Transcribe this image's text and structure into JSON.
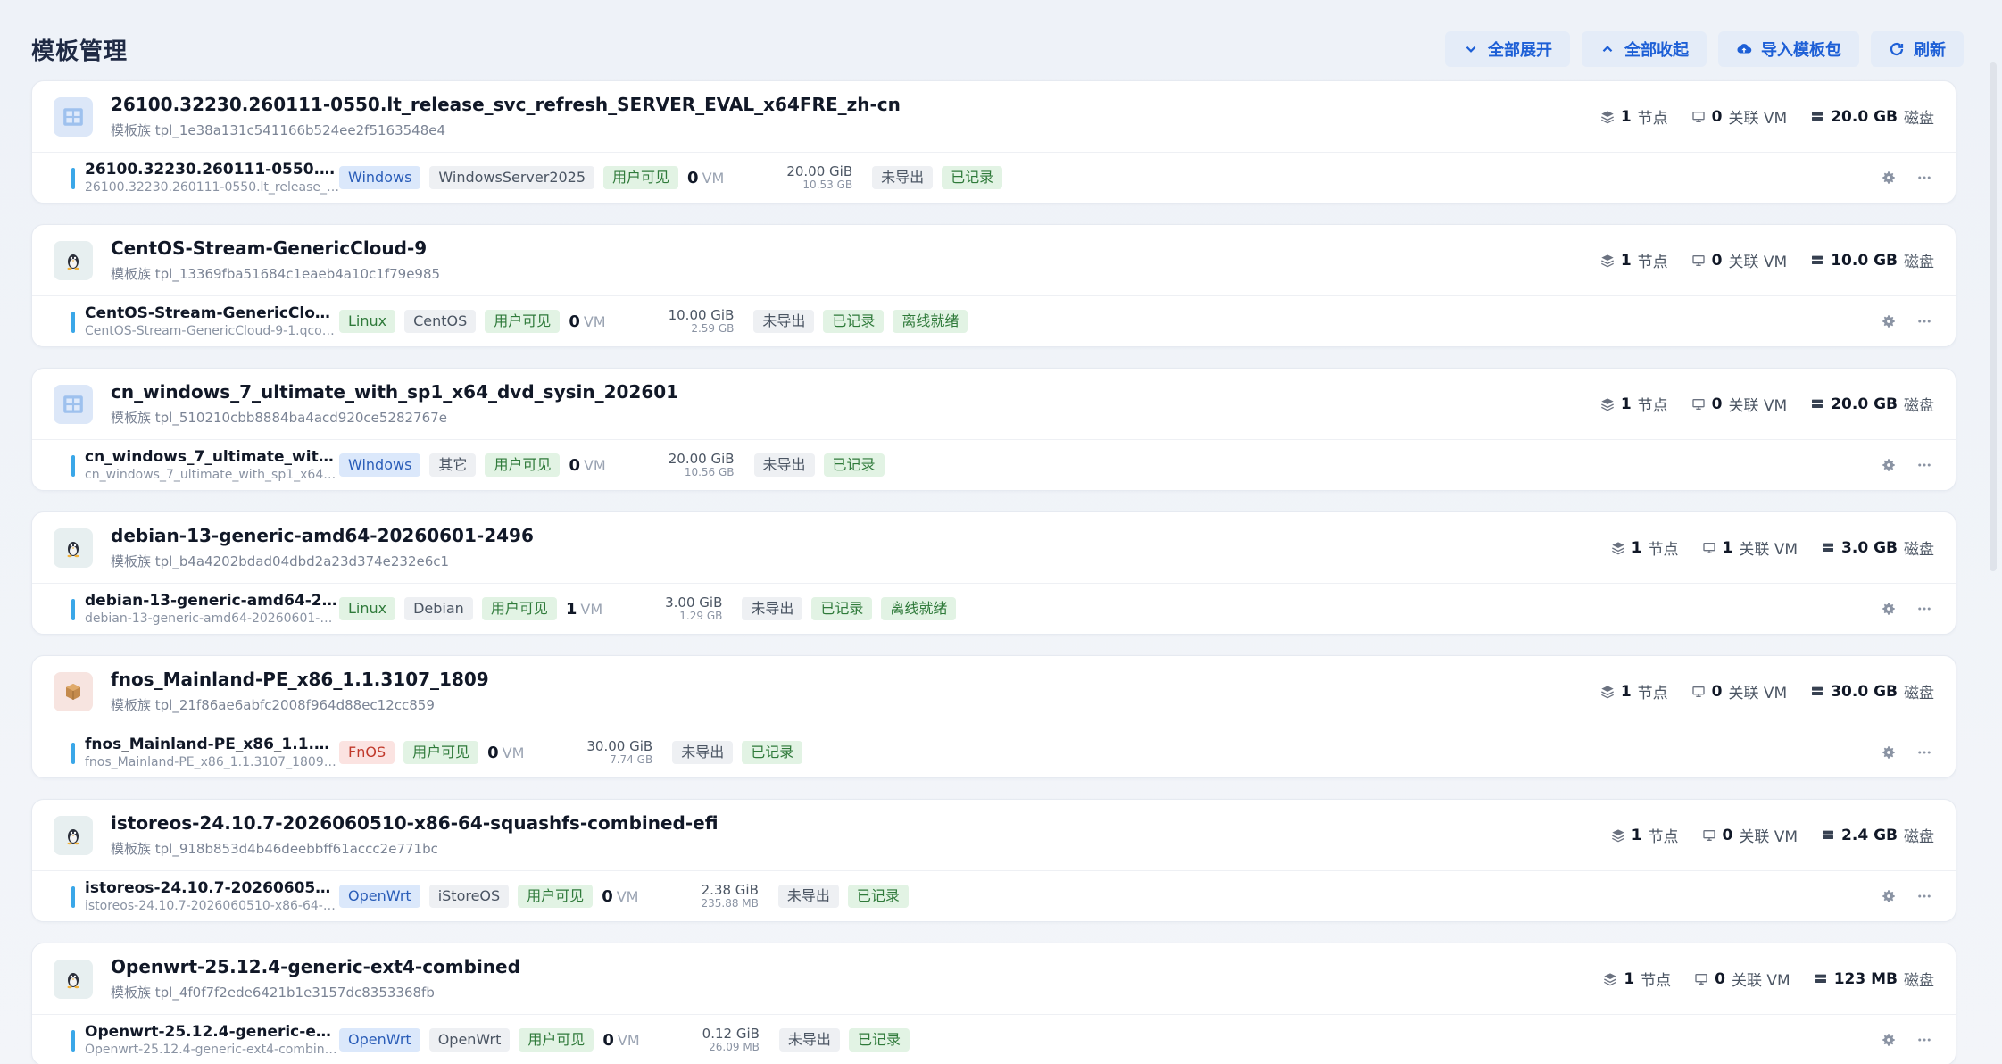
{
  "page": {
    "title": "模板管理",
    "actions": {
      "expand_all": "全部展开",
      "collapse_all": "全部收起",
      "import": "导入模板包",
      "refresh": "刷新"
    }
  },
  "labels": {
    "nodes": "节点",
    "vms": "关联 VM",
    "disk": "磁盘",
    "vm_unit": "VM"
  },
  "templates": [
    {
      "name": "26100.32230.260111-0550.lt_release_svc_refresh_SERVER_EVAL_x64FRE_zh-cn",
      "family": "模板族 tpl_1e38a131c541166b524ee2f5163548e4",
      "icon": "windows-icon",
      "nodes": "1",
      "vms": "0",
      "disk": "20.0 GB",
      "version": {
        "name": "26100.32230.260111-0550.lt_re...",
        "file": "26100.32230.260111-0550.lt_release_sv...",
        "tags": [
          {
            "text": "Windows",
            "style": "blue"
          },
          {
            "text": "WindowsServer2025",
            "style": "gray"
          },
          {
            "text": "用户可见",
            "style": "green"
          }
        ],
        "vm_count": "0",
        "size": "20.00 GiB",
        "actual": "10.53 GB",
        "status_tags": [
          {
            "text": "未导出",
            "style": "gray"
          },
          {
            "text": "已记录",
            "style": "green"
          }
        ]
      }
    },
    {
      "name": "CentOS-Stream-GenericCloud-9",
      "family": "模板族 tpl_13369fba51684c1eaeb4a10c1f79e985",
      "icon": "linux-icon",
      "nodes": "1",
      "vms": "0",
      "disk": "10.0 GB",
      "version": {
        "name": "CentOS-Stream-GenericCloud-9",
        "file": "CentOS-Stream-GenericCloud-9-1.qcow2",
        "tags": [
          {
            "text": "Linux",
            "style": "green"
          },
          {
            "text": "CentOS",
            "style": "gray"
          },
          {
            "text": "用户可见",
            "style": "green"
          }
        ],
        "vm_count": "0",
        "size": "10.00 GiB",
        "actual": "2.59 GB",
        "status_tags": [
          {
            "text": "未导出",
            "style": "gray"
          },
          {
            "text": "已记录",
            "style": "green"
          },
          {
            "text": "离线就绪",
            "style": "green"
          }
        ]
      }
    },
    {
      "name": "cn_windows_7_ultimate_with_sp1_x64_dvd_sysin_202601",
      "family": "模板族 tpl_510210cbb8884ba4acd920ce5282767e",
      "icon": "windows-icon",
      "nodes": "1",
      "vms": "0",
      "disk": "20.0 GB",
      "version": {
        "name": "cn_windows_7_ultimate_with_s...",
        "file": "cn_windows_7_ultimate_with_sp1_x64_d...",
        "tags": [
          {
            "text": "Windows",
            "style": "blue"
          },
          {
            "text": "其它",
            "style": "gray"
          },
          {
            "text": "用户可见",
            "style": "green"
          }
        ],
        "vm_count": "0",
        "size": "20.00 GiB",
        "actual": "10.56 GB",
        "status_tags": [
          {
            "text": "未导出",
            "style": "gray"
          },
          {
            "text": "已记录",
            "style": "green"
          }
        ]
      }
    },
    {
      "name": "debian-13-generic-amd64-20260601-2496",
      "family": "模板族 tpl_b4a4202bdad04dbd2a23d374e232e6c1",
      "icon": "linux-icon",
      "nodes": "1",
      "vms": "1",
      "disk": "3.0 GB",
      "version": {
        "name": "debian-13-generic-amd64-202...",
        "file": "debian-13-generic-amd64-20260601-2...",
        "tags": [
          {
            "text": "Linux",
            "style": "green"
          },
          {
            "text": "Debian",
            "style": "gray"
          },
          {
            "text": "用户可见",
            "style": "green"
          }
        ],
        "vm_count": "1",
        "size": "3.00 GiB",
        "actual": "1.29 GB",
        "status_tags": [
          {
            "text": "未导出",
            "style": "gray"
          },
          {
            "text": "已记录",
            "style": "green"
          },
          {
            "text": "离线就绪",
            "style": "green"
          }
        ]
      }
    },
    {
      "name": "fnos_Mainland-PE_x86_1.1.3107_1809",
      "family": "模板族 tpl_21f86ae6abfc2008f964d88ec12cc859",
      "icon": "package-icon",
      "nodes": "1",
      "vms": "0",
      "disk": "30.0 GB",
      "version": {
        "name": "fnos_Mainland-PE_x86_1.1.310...",
        "file": "fnos_Mainland-PE_x86_1.1.3107_1809.q...",
        "tags": [
          {
            "text": "FnOS",
            "style": "red"
          },
          {
            "text": "用户可见",
            "style": "green"
          }
        ],
        "vm_count": "0",
        "size": "30.00 GiB",
        "actual": "7.74 GB",
        "status_tags": [
          {
            "text": "未导出",
            "style": "gray"
          },
          {
            "text": "已记录",
            "style": "green"
          }
        ]
      }
    },
    {
      "name": "istoreos-24.10.7-2026060510-x86-64-squashfs-combined-efi",
      "family": "模板族 tpl_918b853d4b46deebbff61accc2e771bc",
      "icon": "linux-icon",
      "nodes": "1",
      "vms": "0",
      "disk": "2.4 GB",
      "version": {
        "name": "istoreos-24.10.7-2026060510-x...",
        "file": "istoreos-24.10.7-2026060510-x86-64-sq...",
        "tags": [
          {
            "text": "OpenWrt",
            "style": "blue"
          },
          {
            "text": "iStoreOS",
            "style": "gray"
          },
          {
            "text": "用户可见",
            "style": "green"
          }
        ],
        "vm_count": "0",
        "size": "2.38 GiB",
        "actual": "235.88 MB",
        "status_tags": [
          {
            "text": "未导出",
            "style": "gray"
          },
          {
            "text": "已记录",
            "style": "green"
          }
        ]
      }
    },
    {
      "name": "Openwrt-25.12.4-generic-ext4-combined",
      "family": "模板族 tpl_4f0f7f2ede6421b1e3157dc8353368fb",
      "icon": "linux-icon",
      "nodes": "1",
      "vms": "0",
      "disk": "123 MB",
      "version": {
        "name": "Openwrt-25.12.4-generic-ext4-...",
        "file": "Openwrt-25.12.4-generic-ext4-combine...",
        "tags": [
          {
            "text": "OpenWrt",
            "style": "blue"
          },
          {
            "text": "OpenWrt",
            "style": "gray"
          },
          {
            "text": "用户可见",
            "style": "green"
          }
        ],
        "vm_count": "0",
        "size": "0.12 GiB",
        "actual": "26.09 MB",
        "status_tags": [
          {
            "text": "未导出",
            "style": "gray"
          },
          {
            "text": "已记录",
            "style": "green"
          }
        ]
      }
    }
  ]
}
